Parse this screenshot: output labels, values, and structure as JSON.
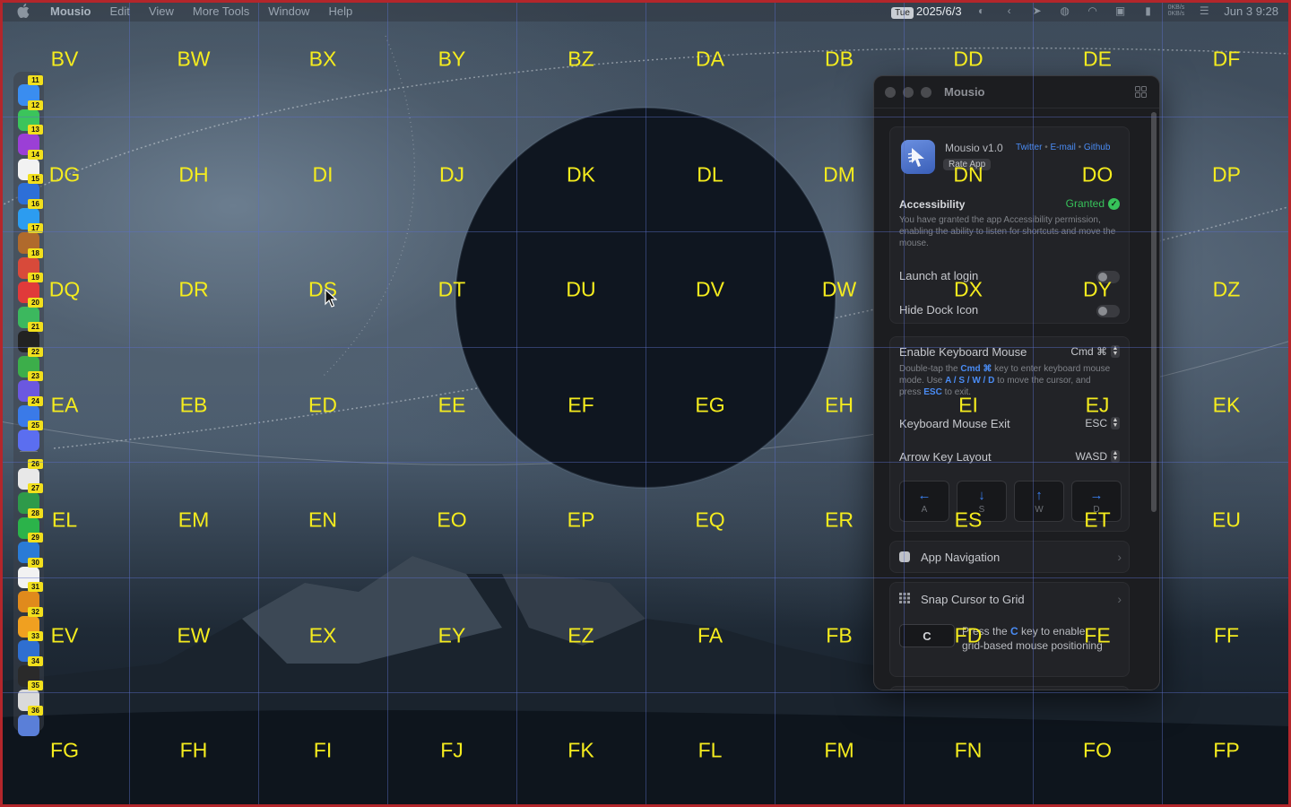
{
  "menubar": {
    "app_name": "Mousio",
    "menus": [
      "Edit",
      "View",
      "More Tools",
      "Window",
      "Help"
    ],
    "day_badge": "Tue",
    "date": "2025/6/3",
    "net_up": "0KB/s",
    "net_down": "0KB/s",
    "clock": "Jun 3  9:28"
  },
  "grid": {
    "rows": [
      [
        "BV",
        "BW",
        "BX",
        "BY",
        "BZ",
        "DA",
        "DB",
        "DD",
        "DE",
        "DF"
      ],
      [
        "DG",
        "DH",
        "DI",
        "DJ",
        "DK",
        "DL",
        "DM",
        "DN",
        "DO",
        "DP"
      ],
      [
        "DQ",
        "DR",
        "DS",
        "DT",
        "DU",
        "DV",
        "DW",
        "DX",
        "DY",
        "DZ"
      ],
      [
        "EA",
        "EB",
        "ED",
        "EE",
        "EF",
        "EG",
        "EH",
        "EI",
        "EJ",
        "EK"
      ],
      [
        "EL",
        "EM",
        "EN",
        "EO",
        "EP",
        "EQ",
        "ER",
        "ES",
        "ET",
        "EU"
      ],
      [
        "EV",
        "EW",
        "EX",
        "EY",
        "EZ",
        "FA",
        "FB",
        "FD",
        "FE",
        "FF"
      ],
      [
        "FG",
        "FH",
        "FI",
        "FJ",
        "FK",
        "FL",
        "FM",
        "FN",
        "FO",
        "FP"
      ]
    ]
  },
  "dock": {
    "badges": [
      "11",
      "12",
      "13",
      "14",
      "15",
      "16",
      "17",
      "18",
      "19",
      "20",
      "21",
      "22",
      "23",
      "24",
      "25",
      "26",
      "27",
      "28",
      "29",
      "30",
      "31",
      "32",
      "33",
      "34",
      "35",
      "36"
    ],
    "icon_colors": [
      "#3a8df0",
      "#3bc45b",
      "#9b3fd6",
      "#f2f2f2",
      "#2d6fd8",
      "#2c9cf0",
      "#b06a2c",
      "#d84a3a",
      "#e03a3a",
      "#3cb85e",
      "#222",
      "#3cae4a",
      "#6b58e0",
      "#3a7ae8",
      "#5b6ef0",
      "#e8e8e8",
      "#2e9a4a",
      "#2bb34a",
      "#2a7bd6",
      "#f2f2f2",
      "#e08a1c",
      "#f0a020",
      "#2f6fd0",
      "#2a2a2a",
      "#dadada",
      "#5a7fd8"
    ]
  },
  "window": {
    "title": "Mousio",
    "app_version": "Mousio v1.0",
    "links": {
      "twitter": "Twitter",
      "sep": " • ",
      "email": "E-mail",
      "github": "Github"
    },
    "rate_button": "Rate App",
    "accessibility": {
      "title": "Accessibility",
      "status": "Granted",
      "description": "You have granted the app Accessibility permission, enabling the ability to listen for shortcuts and move the mouse."
    },
    "launch_at_login": "Launch at login",
    "hide_dock_icon": "Hide Dock Icon",
    "keyboard_mouse": {
      "title": "Enable Keyboard Mouse",
      "value": "Cmd ⌘",
      "desc_1": "Double-tap the ",
      "desc_key": "Cmd ⌘",
      "desc_2": " key to enter keyboard mouse mode. Use ",
      "desc_keys": "A / S / W / D",
      "desc_3": " to move the cursor, and press ",
      "desc_esc": "ESC",
      "desc_4": " to exit."
    },
    "exit": {
      "label": "Keyboard Mouse Exit",
      "value": "ESC"
    },
    "layout": {
      "label": "Arrow Key Layout",
      "value": "WASD"
    },
    "arrow_keys": [
      {
        "arrow": "←",
        "key": "A"
      },
      {
        "arrow": "↓",
        "key": "S"
      },
      {
        "arrow": "↑",
        "key": "W"
      },
      {
        "arrow": "→",
        "key": "D"
      }
    ],
    "app_navigation": "App Navigation",
    "snap": {
      "title": "Snap Cursor to Grid",
      "key": "C",
      "desc_1": "Press the ",
      "desc_key": "C",
      "desc_2": " key to enable grid-based mouse positioning"
    }
  }
}
